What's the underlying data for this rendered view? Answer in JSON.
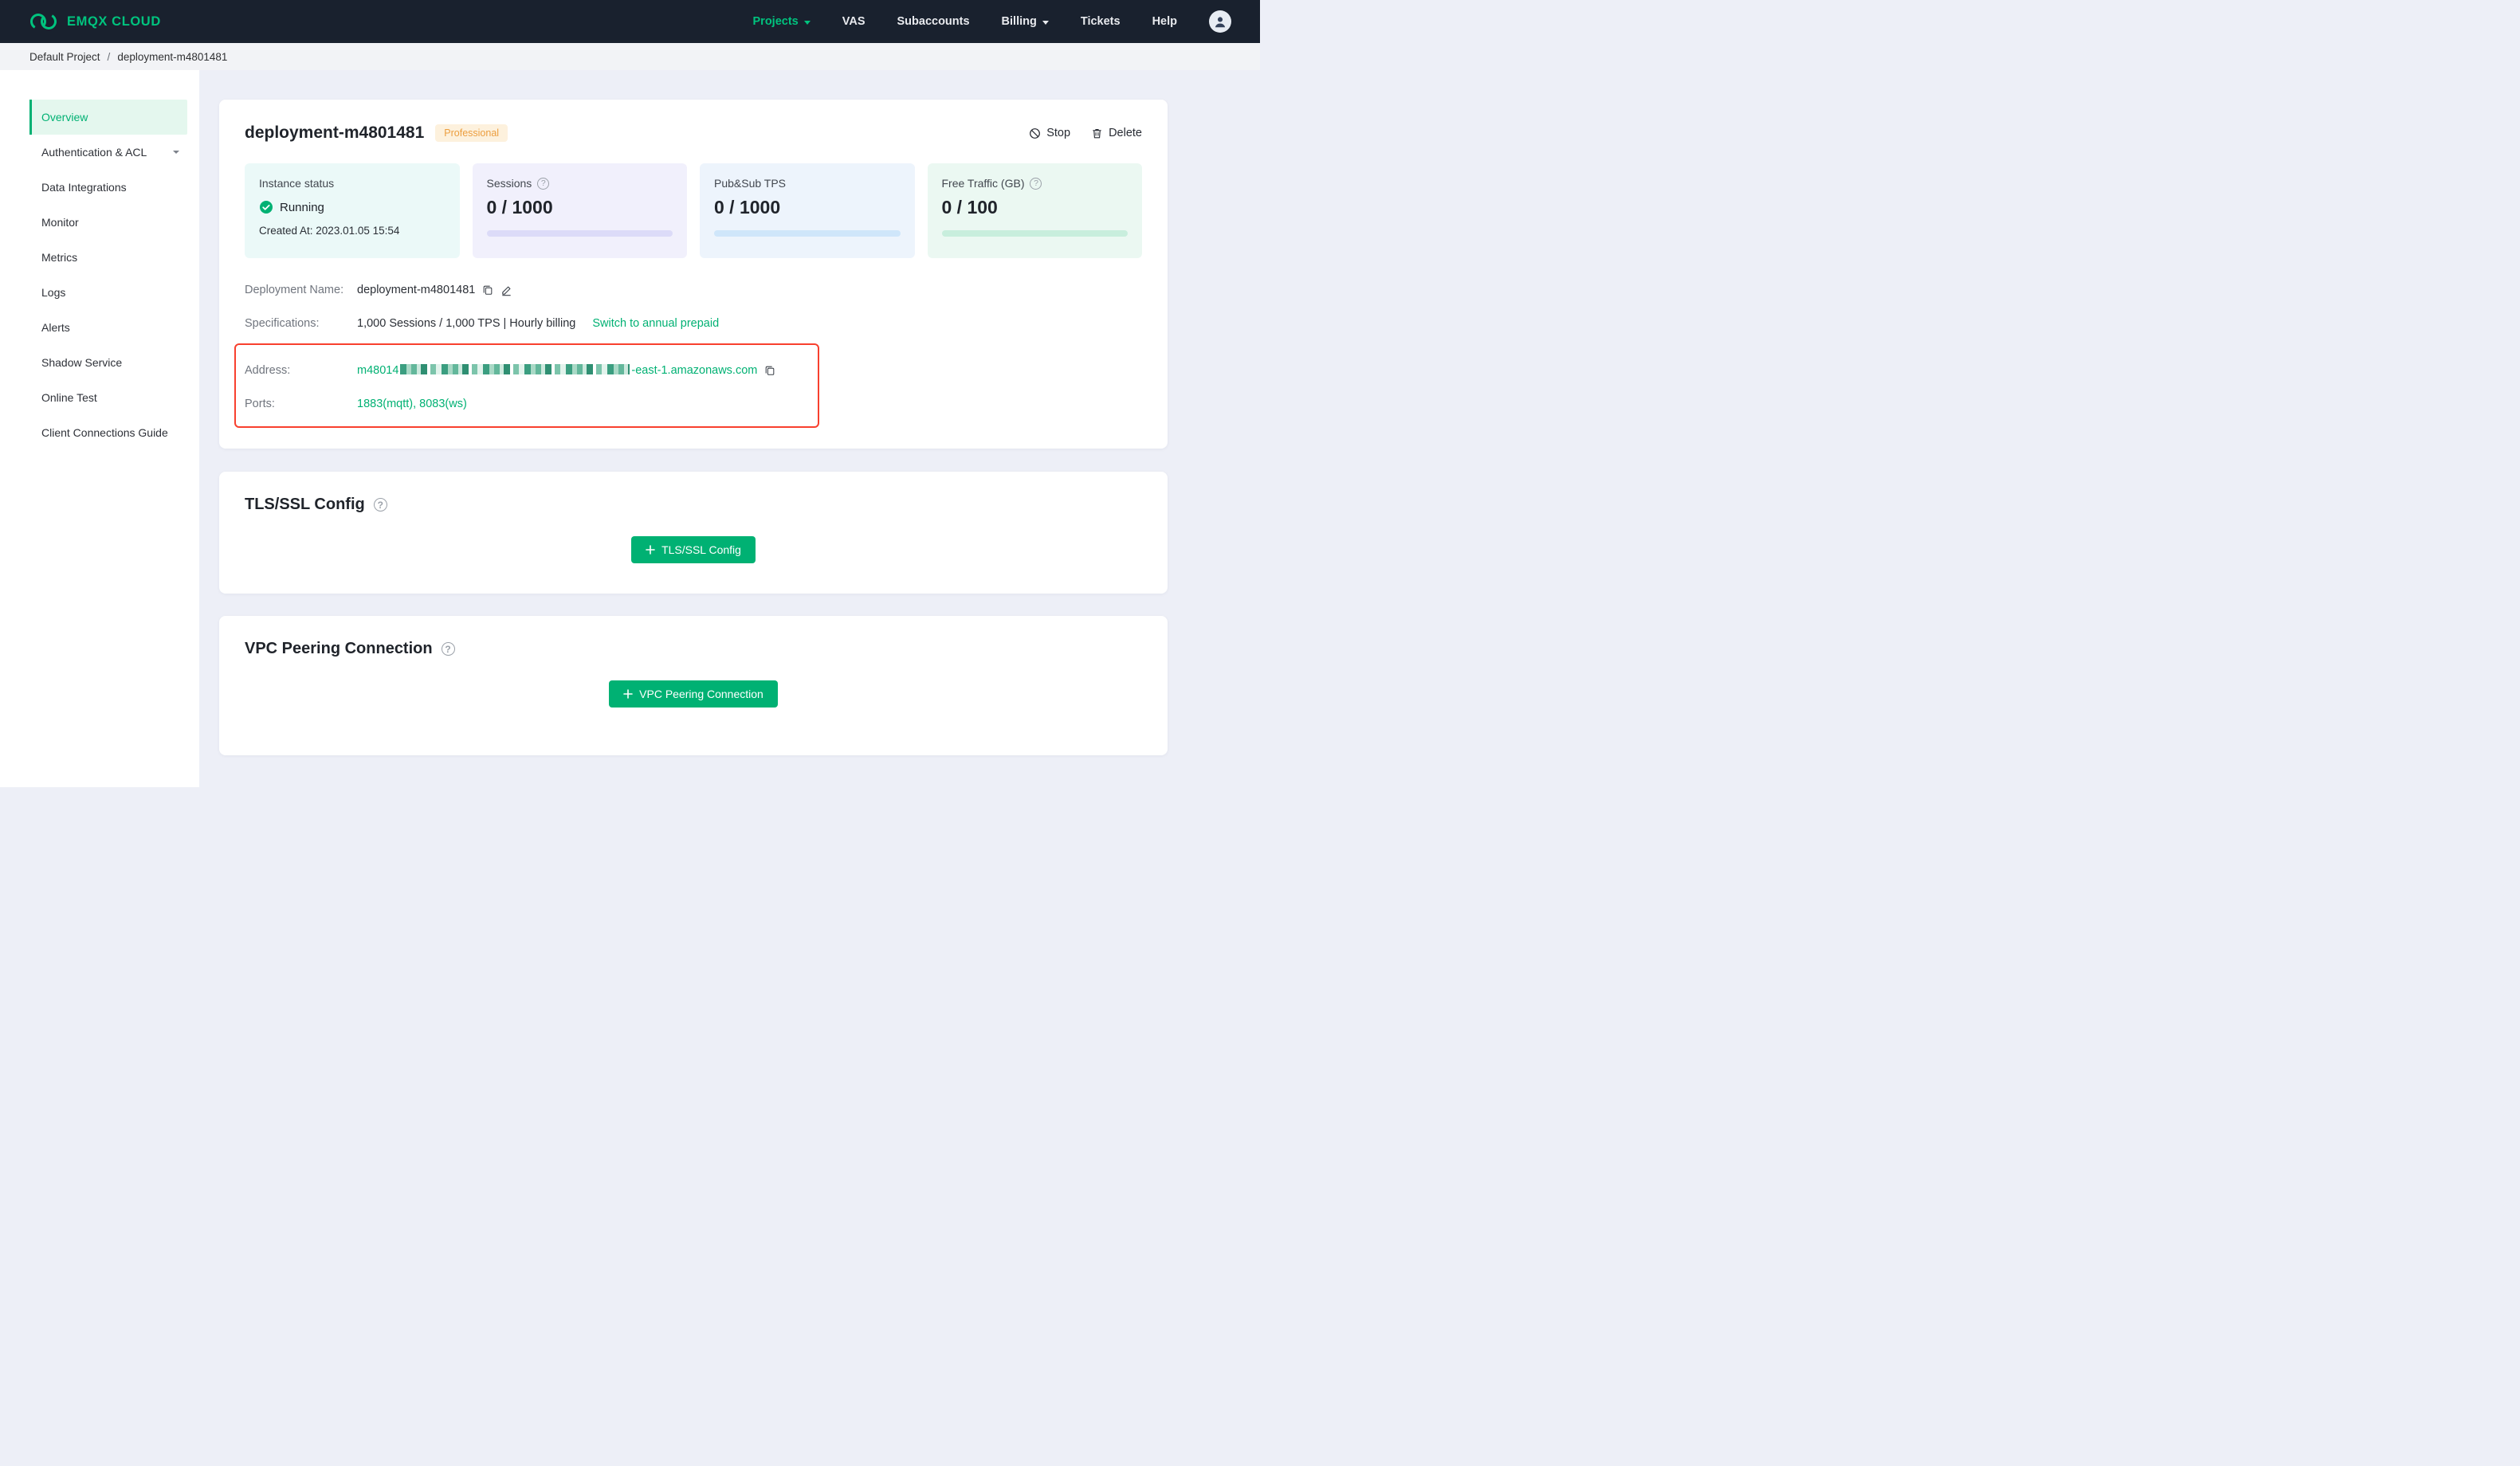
{
  "navbar": {
    "brand": "EMQX CLOUD",
    "items": [
      {
        "label": "Projects",
        "active": true,
        "has_caret": true
      },
      {
        "label": "VAS"
      },
      {
        "label": "Subaccounts"
      },
      {
        "label": "Billing",
        "has_caret": true
      },
      {
        "label": "Tickets"
      },
      {
        "label": "Help"
      }
    ]
  },
  "breadcrumb": {
    "project": "Default Project",
    "separator": "/",
    "deployment": "deployment-m4801481"
  },
  "sidebar": {
    "items": [
      {
        "label": "Overview",
        "active": true
      },
      {
        "label": "Authentication & ACL",
        "has_caret": true
      },
      {
        "label": "Data Integrations"
      },
      {
        "label": "Monitor"
      },
      {
        "label": "Metrics"
      },
      {
        "label": "Logs"
      },
      {
        "label": "Alerts"
      },
      {
        "label": "Shadow Service"
      },
      {
        "label": "Online Test"
      },
      {
        "label": "Client Connections Guide"
      }
    ]
  },
  "deployment": {
    "title": "deployment-m4801481",
    "badge": "Professional",
    "actions": {
      "stop": "Stop",
      "delete": "Delete"
    },
    "stats": [
      {
        "label": "Instance status",
        "value": "Running",
        "created": "Created At: 2023.01.05 15:54"
      },
      {
        "label": "Sessions",
        "value": "0 / 1000",
        "used": 0,
        "total": 1000,
        "has_help": true
      },
      {
        "label": "Pub&Sub TPS",
        "value": "0 / 1000",
        "used": 0,
        "total": 1000
      },
      {
        "label": "Free Traffic (GB)",
        "value": "0 / 100",
        "used": 0,
        "total": 100,
        "has_help": true
      }
    ],
    "details": {
      "deployment_name_label": "Deployment Name:",
      "deployment_name_value": "deployment-m4801481",
      "specifications_label": "Specifications:",
      "specifications_value": "1,000 Sessions / 1,000 TPS | Hourly billing",
      "specifications_link": "Switch to annual prepaid",
      "address_label": "Address:",
      "address_prefix": "m48014",
      "address_redacted": true,
      "address_suffix": "-east-1.amazonaws.com",
      "ports_label": "Ports:",
      "ports_value": "1883(mqtt), 8083(ws)"
    }
  },
  "sections": {
    "tls": {
      "title": "TLS/SSL Config",
      "button": "TLS/SSL Config"
    },
    "vpc": {
      "title": "VPC Peering Connection",
      "button": "VPC Peering Connection"
    }
  },
  "colors": {
    "accent_green": "#00b173",
    "brand_green": "#00c37e",
    "badge_bg": "#fdf1dd",
    "badge_text": "#ec9e3f",
    "highlight_border": "#f8402e",
    "status_running": "#00b173",
    "navbar_bg": "#19212e"
  }
}
